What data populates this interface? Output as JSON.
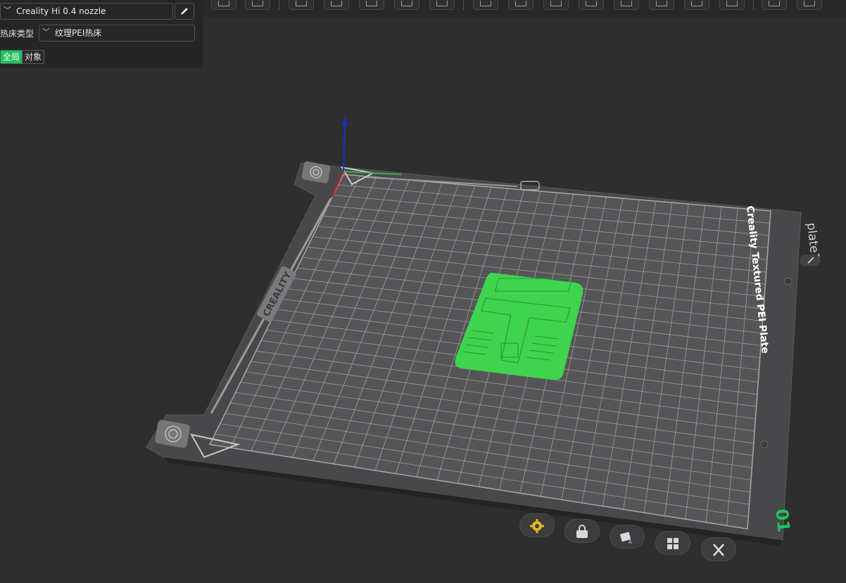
{
  "panel": {
    "printer_select": "Creality Hi 0.4 nozzle",
    "bed_type_label": "热床类型",
    "bed_type_select": "纹理PEI热床",
    "scope_tabs": [
      {
        "label": "全局",
        "active": true
      },
      {
        "label": "对象",
        "active": false
      }
    ]
  },
  "toolbar": {
    "icons": [
      "cube-view-icon",
      "keyboard-icon",
      "orient-icon",
      "arrange-icon",
      "auto-arrange-icon",
      "split-icon",
      "layout-icon",
      "place-icon",
      "layers-icon",
      "support-icon",
      "measure-icon",
      "cut-icon",
      "paint-icon",
      "seam-icon",
      "fuzzy-icon",
      "text-icon",
      "assembly-icon",
      "variable-layer-icon"
    ]
  },
  "plate": {
    "name": "plate1",
    "number": "01",
    "brand_text": "CREALITY",
    "side_text": "Creality Textured PEI Plate",
    "bed_color": "#4a4a4c",
    "model_color": "#3fd44d"
  },
  "plate_buttons": [
    {
      "name": "settings",
      "icon": "gear-icon"
    },
    {
      "name": "lock",
      "icon": "lock-icon"
    },
    {
      "name": "auto-orient",
      "icon": "auto-orient-icon"
    },
    {
      "name": "arrange",
      "icon": "arrange-icon"
    },
    {
      "name": "delete",
      "icon": "close-icon"
    }
  ]
}
